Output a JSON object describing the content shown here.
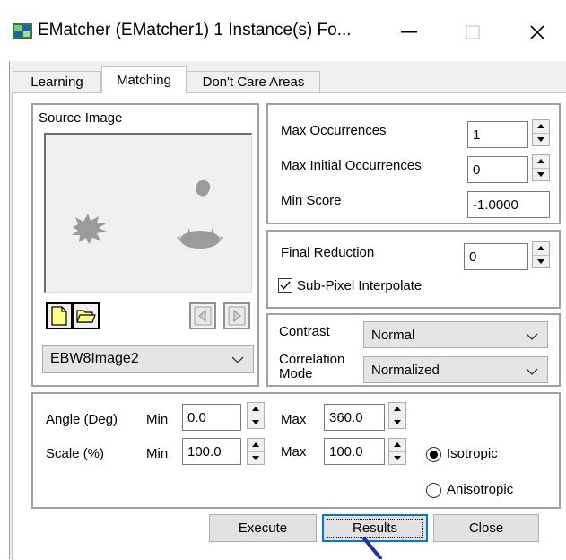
{
  "window": {
    "title": "EMatcher (EMatcher1) 1 Instance(s) Fo...",
    "min_glyph": "—",
    "close_glyph": "✕"
  },
  "tabs": [
    {
      "label": "Learning",
      "active": false
    },
    {
      "label": "Matching",
      "active": true
    },
    {
      "label": "Don't Care Areas",
      "active": false
    }
  ],
  "source": {
    "label": "Source Image",
    "image_selection": "EBW8Image2"
  },
  "occurrences": {
    "max_occurrences_label": "Max Occurrences",
    "max_occurrences_value": "1",
    "max_initial_label": "Max Initial Occurrences",
    "max_initial_value": "0",
    "min_score_label": "Min Score",
    "min_score_value": "-1.0000"
  },
  "final": {
    "final_reduction_label": "Final Reduction",
    "final_reduction_value": "0",
    "subpixel_label": "Sub-Pixel Interpolate",
    "subpixel_checked": true
  },
  "contrast": {
    "contrast_label": "Contrast",
    "contrast_value": "Normal",
    "correlation_label_1": "Correlation",
    "correlation_label_2": "Mode",
    "correlation_value": "Normalized"
  },
  "params": {
    "angle_label": "Angle (Deg)",
    "scale_label": "Scale (%)",
    "min_label": "Min",
    "max_label": "Max",
    "angle_min": "0.0",
    "angle_max": "360.0",
    "scale_min": "100.0",
    "scale_max": "100.0",
    "isotropic_label": "Isotropic",
    "anisotropic_label": "Anisotropic",
    "isotropic_selected": true
  },
  "buttons": {
    "execute": "Execute",
    "results": "Results",
    "close": "Close"
  },
  "colors": {
    "accent": "#0078d7",
    "pointer": "#1a2fa8",
    "shape_fill": "#9a9a9a"
  }
}
